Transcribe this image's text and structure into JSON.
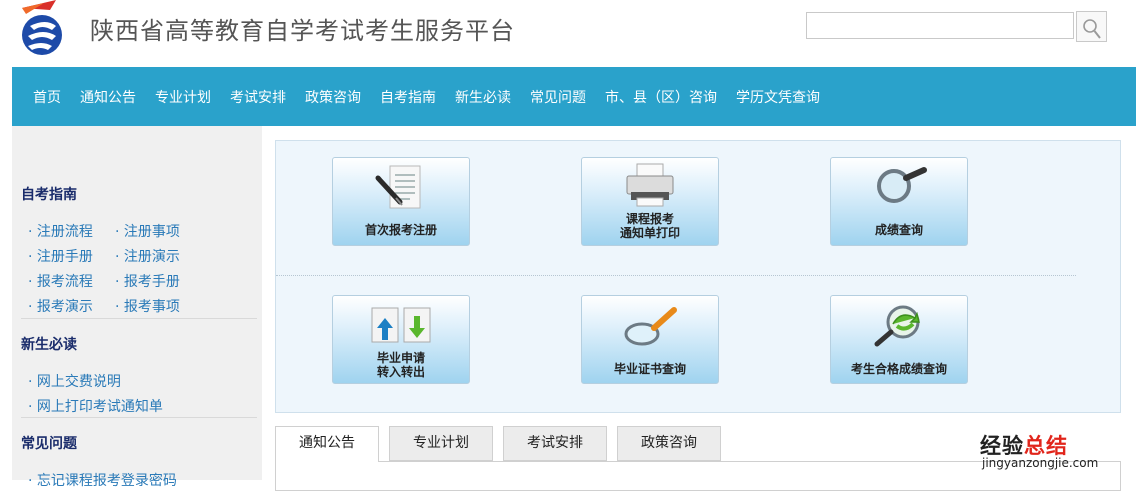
{
  "header": {
    "site_title": "陕西省高等教育自学考试考生服务平台",
    "search_value": "",
    "search_placeholder": ""
  },
  "nav": {
    "items": [
      "首页",
      "通知公告",
      "专业计划",
      "考试安排",
      "政策咨询",
      "自考指南",
      "新生必读",
      "常见问题",
      "市、县（区）咨询",
      "学历文凭查询"
    ]
  },
  "sidebar": {
    "sections": [
      {
        "title": "自考指南",
        "links": [
          "注册流程",
          "注册事项",
          "注册手册",
          "注册演示",
          "报考流程",
          "报考手册",
          "报考演示",
          "报考事项"
        ]
      },
      {
        "title": "新生必读",
        "links": [
          "网上交费说明",
          "网上打印考试通知单"
        ]
      },
      {
        "title": "常见问题",
        "links": [
          "忘记课程报考登录密码"
        ]
      }
    ]
  },
  "services": [
    {
      "label": "首次报考注册",
      "icon": "document-pen-icon"
    },
    {
      "label": "课程报考\n通知单打印",
      "icon": "printer-icon"
    },
    {
      "label": "成绩查询",
      "icon": "magnifier-icon"
    },
    {
      "label": "毕业申请\n转入转出",
      "icon": "transfer-documents-icon"
    },
    {
      "label": "毕业证书查询",
      "icon": "certificate-search-icon"
    },
    {
      "label": "考生合格成绩查询",
      "icon": "qualified-score-search-icon"
    }
  ],
  "tabs": {
    "items": [
      "通知公告",
      "专业计划",
      "考试安排",
      "政策咨询"
    ],
    "active": "通知公告"
  },
  "watermark": {
    "line1_prefix": "经验",
    "line1_highlight": "总结",
    "line2": "jingyanzongjie.com"
  },
  "colors": {
    "nav_bg": "#2aa2cb",
    "sidebar_title": "#1a2c6b",
    "sidebar_link": "#2a7ab8",
    "watermark_highlight": "#e1251b"
  }
}
